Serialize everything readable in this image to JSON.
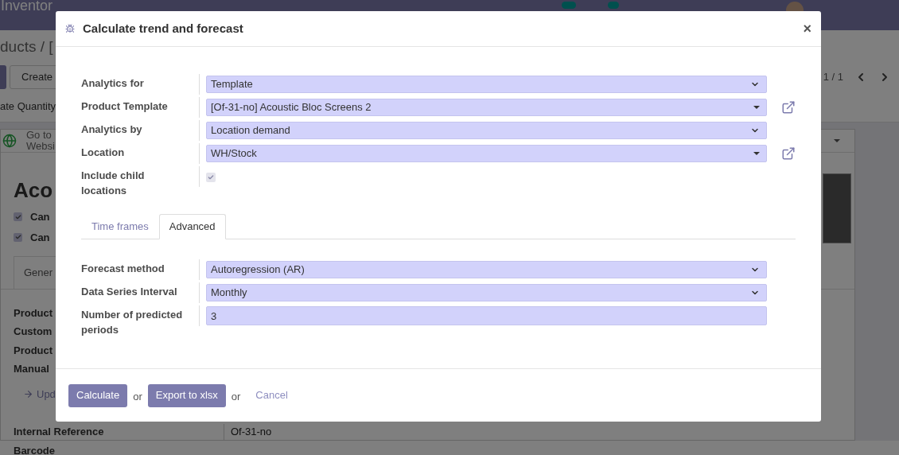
{
  "navbar": {
    "app_name": "Inventor"
  },
  "background": {
    "breadcrumb": "ducts / [",
    "create_button": "Create",
    "pager": "1 / 1",
    "action": "ate Quantity",
    "website_button": [
      "Go to",
      "Websi"
    ],
    "title": "Aco",
    "checkboxes": [
      {
        "label": "Can",
        "checked": true
      },
      {
        "label": "Can",
        "checked": true
      }
    ],
    "tab": "Gener",
    "labels": [
      "Product",
      "Custom",
      "Product",
      "Manual"
    ],
    "update_link": "Upd",
    "internal_reference": {
      "label": "Internal Reference",
      "value": "Of-31-no"
    },
    "barcode_label": "Barcode"
  },
  "dialog": {
    "title": "Calculate trend and forecast",
    "close": "×",
    "fields": [
      {
        "kind": "select",
        "label": "Analytics for",
        "value": "Template"
      },
      {
        "kind": "many2one",
        "label": "Product Template",
        "value": "[Of-31-no] Acoustic Bloc Screens 2"
      },
      {
        "kind": "select",
        "label": "Analytics by",
        "value": "Location demand"
      },
      {
        "kind": "many2one",
        "label": "Location",
        "value": "WH/Stock"
      },
      {
        "kind": "checkbox",
        "label": "Include child locations",
        "checked": true
      }
    ],
    "tabs": [
      {
        "label": "Time frames",
        "selected": false
      },
      {
        "label": "Advanced",
        "selected": true
      }
    ],
    "advanced_fields": [
      {
        "kind": "select",
        "label": "Forecast method",
        "value": "Autoregression (AR)"
      },
      {
        "kind": "select",
        "label": "Data Series Interval",
        "value": "Monthly"
      },
      {
        "kind": "input",
        "label": "Number of predicted periods",
        "value": "3"
      }
    ],
    "footer": [
      {
        "kind": "button",
        "label": "Calculate"
      },
      {
        "kind": "separator",
        "label": "or"
      },
      {
        "kind": "button",
        "label": "Export to xlsx"
      },
      {
        "kind": "separator",
        "label": "or"
      },
      {
        "kind": "link",
        "label": "Cancel"
      }
    ]
  }
}
